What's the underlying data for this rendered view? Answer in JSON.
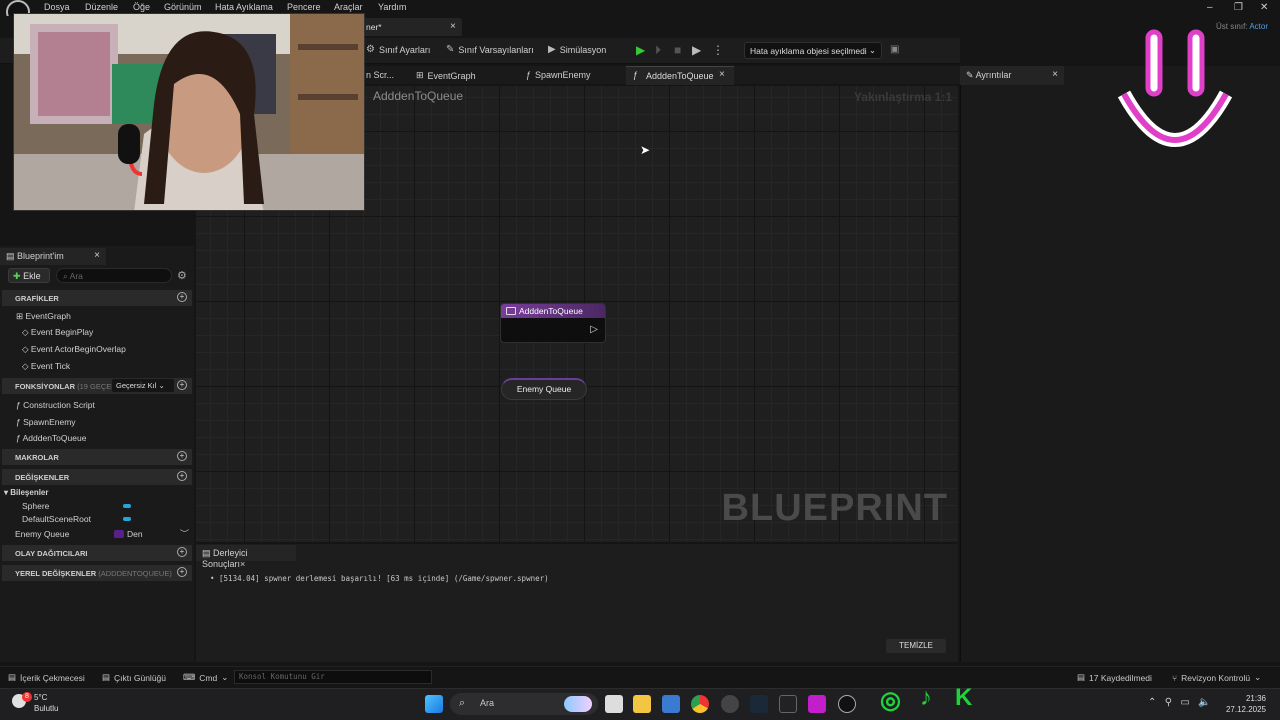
{
  "menu": [
    "Dosya",
    "Düzenle",
    "Öğe",
    "Görünüm",
    "Hata Ayıklama",
    "Pencere",
    "Araçlar",
    "Yardım"
  ],
  "asset_tab": {
    "label": "ner*",
    "close": "×"
  },
  "parent_class": {
    "label": "Üst sınıf:",
    "value": "Actor"
  },
  "toolbar": {
    "class_settings": "Sınıf Ayarları",
    "class_defaults": "Sınıf Varsayılanları",
    "simulation": "Simülasyon",
    "debug_select": "Hata ayıklama objesi seçilmedi"
  },
  "graph_tabs": {
    "construction": "n Scr...",
    "event_graph": "EventGraph",
    "spawn_enemy": "SpawnEnemy",
    "active": "AdddenToQueue",
    "close": "×"
  },
  "graph": {
    "title": "AdddenToQueue",
    "zoom": "Yakınlaştırma 1:1",
    "watermark": "BLUEPRINT",
    "entry_node": "AdddenToQueue",
    "var_node": "Enemy Queue"
  },
  "details": {
    "tab": "Ayrıntılar",
    "close": "×"
  },
  "my_blueprint": {
    "tab": "Blueprint'im",
    "close": "×",
    "add": "Ekle",
    "search_placeholder": "Ara",
    "sections": {
      "graphs": "GRAFİKLER",
      "functions": "FONKSİYONLAR",
      "functions_count": "(19 GEÇERSİ",
      "functions_override": "Geçersiz Kıl",
      "macros": "MAKROLAR",
      "variables": "DEĞİŞKENLER",
      "dispatchers": "OLAY DAĞITICILARI",
      "local_vars": "YEREL DEĞİŞKENLER",
      "local_vars_scope": "(ADDDENTOQUEUE)"
    },
    "graph_items": [
      "EventGraph",
      "Event BeginPlay",
      "Event ActorBeginOverlap",
      "Event Tick"
    ],
    "function_items": [
      "Construction Script",
      "SpawnEnemy",
      "AdddenToQueue"
    ],
    "components_label": "Bileşenler",
    "component_items": [
      "Sphere",
      "DefaultSceneRoot"
    ],
    "variable": {
      "name": "Enemy Queue",
      "type": "Den"
    }
  },
  "compiler": {
    "tab": "Derleyici Sonuçları",
    "close": "×",
    "log": "[5134.04] spwner derlemesi başarılı! [63 ms içinde] (/Game/spwner.spwner)",
    "clear": "TEMİZLE"
  },
  "statusbar": {
    "content_drawer": "İçerik Çekmecesi",
    "output_log": "Çıktı Günlüğü",
    "cmd": "Cmd",
    "console_placeholder": "Konsol Komutunu Gir",
    "saved": "17 Kaydedilmedi",
    "revision": "Revizyon Kontrolü"
  },
  "taskbar": {
    "weather_temp": "5°C",
    "weather_desc": "Bulutlu",
    "weather_badge": "8",
    "search": "Ara",
    "time": "21:36",
    "date": "27.12.2025"
  },
  "colors": {
    "accent_purple": "#7a3d9b",
    "var_pill": "#27a5d8",
    "play_green": "#38c838",
    "overlay_pink": "#e040c8"
  }
}
